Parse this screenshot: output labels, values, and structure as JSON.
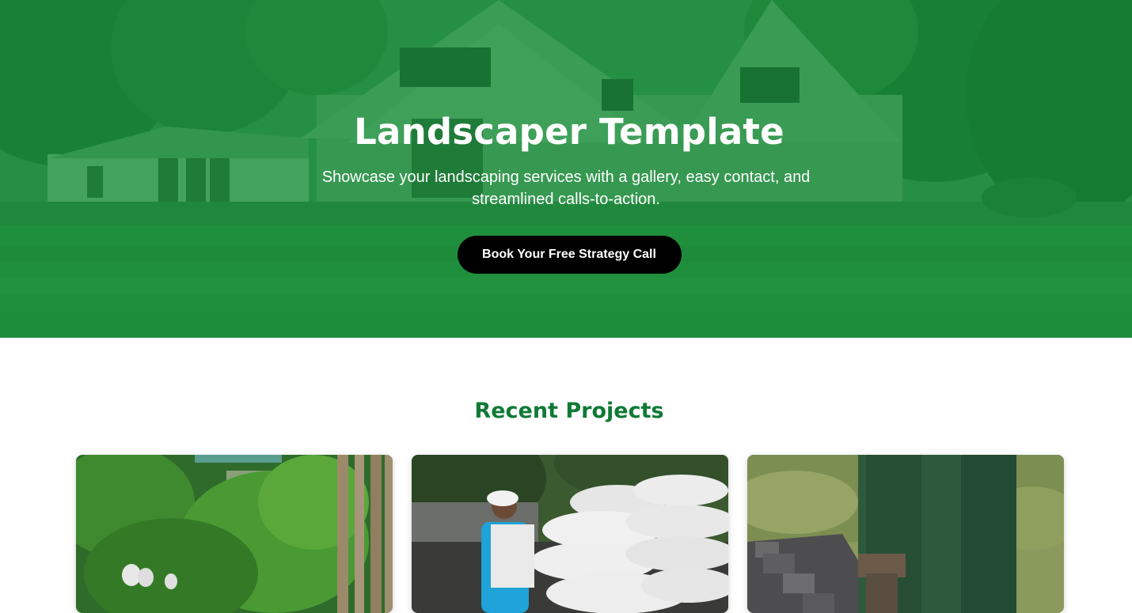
{
  "hero": {
    "title": "Landscaper Template",
    "subtitle": "Showcase your landscaping services with a gallery, easy contact, and streamlined calls-to-action.",
    "cta_label": "Book Your Free Strategy Call"
  },
  "projects": {
    "heading": "Recent Projects",
    "cards": [
      {
        "image": "tropical-garden-photo"
      },
      {
        "image": "worker-carrying-soil-bags-photo"
      },
      {
        "image": "paver-installation-photo"
      }
    ]
  },
  "colors": {
    "hero_overlay": "#148737",
    "heading_green": "#0f7a35",
    "button_bg": "#000000",
    "button_text": "#ffffff"
  }
}
